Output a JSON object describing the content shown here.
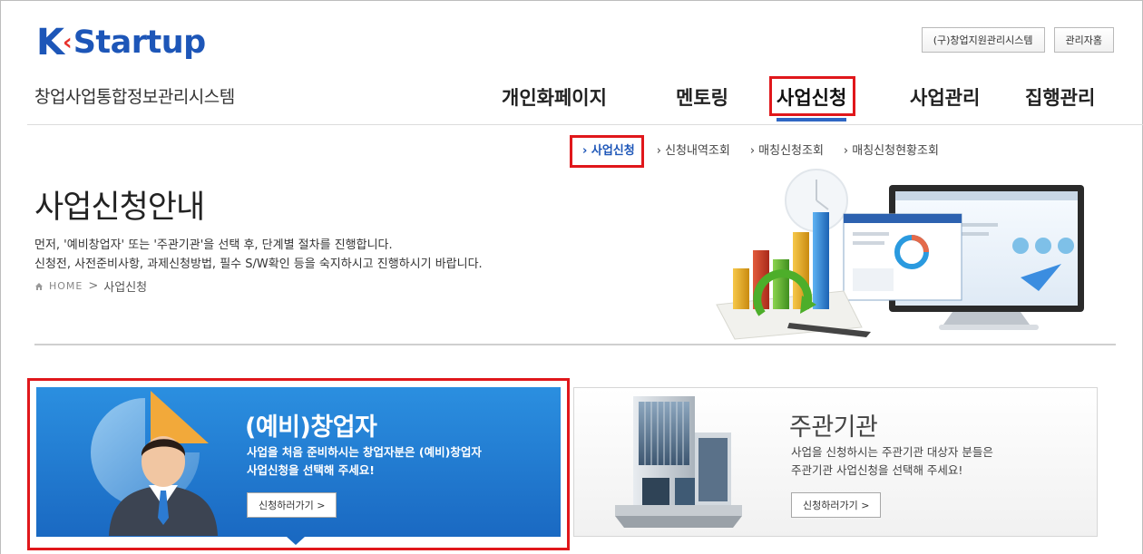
{
  "header": {
    "logo_k": "K",
    "logo_chevron": "‹",
    "logo_word": "Startup",
    "top_buttons": [
      "(구)창업지원관리시스템",
      "관리자홈"
    ],
    "system_name": "창업사업통합정보관리시스템"
  },
  "gnb": {
    "items": [
      "개인화페이지",
      "멘토링",
      "사업신청",
      "사업관리",
      "집행관리"
    ],
    "active": "사업신청",
    "accent_color": "#2f66c4"
  },
  "lnb": {
    "items": [
      "› 사업신청",
      "› 신청내역조회",
      "› 매칭신청조회",
      "› 매칭신청현황조회"
    ],
    "active": "› 사업신청"
  },
  "hero": {
    "title": "사업신청안내",
    "desc_line1": "먼저, '예비창업자' 또는 '주관기관'을 선택 후, 단계별 절차를 진행합니다.",
    "desc_line2": "신청전, 사전준비사항, 과제신청방법, 필수 S/W확인 등을 숙지하시고 진행하시기 바랍니다.",
    "breadcrumb_home": "HOME",
    "breadcrumb_sep": ">",
    "breadcrumb_current": "사업신청",
    "home_icon": "home-icon"
  },
  "cards": {
    "founder": {
      "title": "(예비)창업자",
      "desc_line1": "사업을 처음 준비하시는 창업자분은 (예비)창업자",
      "desc_line2": "사업신청을 선택해 주세요!",
      "button": "신청하러가기 >",
      "color": "#1f78d1"
    },
    "agency": {
      "title": "주관기관",
      "desc_line1": "사업을 신청하시는 주관기관 대상자 분들은",
      "desc_line2": "주관기관 사업신청을 선택해 주세요!",
      "button": "신청하러가기 >"
    }
  },
  "highlight_color": "#e0171b"
}
